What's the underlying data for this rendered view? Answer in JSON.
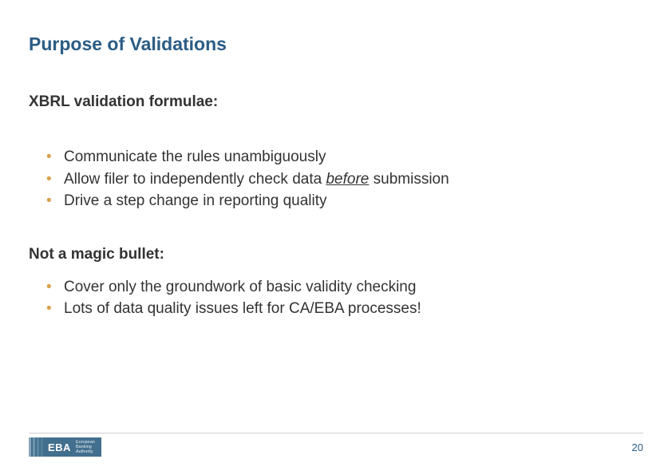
{
  "title": "Purpose of Validations",
  "sections": [
    {
      "heading": "XBRL validation formulae:",
      "items": [
        {
          "pre": "Communicate the rules unambiguously",
          "em": "",
          "post": ""
        },
        {
          "pre": "Allow filer to independently check data ",
          "em": "before",
          "post": " submission"
        },
        {
          "pre": "Drive a step change in reporting quality",
          "em": "",
          "post": ""
        }
      ]
    },
    {
      "heading": "Not a magic bullet:",
      "items": [
        {
          "pre": "Cover only the groundwork of basic validity checking",
          "em": "",
          "post": ""
        },
        {
          "pre": "Lots of data quality issues left for CA/EBA processes!",
          "em": "",
          "post": ""
        }
      ]
    }
  ],
  "footer": {
    "logo_text": "EBA",
    "logo_sub1": "European",
    "logo_sub2": "Banking",
    "logo_sub3": "Authority",
    "page": "20"
  },
  "colors": {
    "title": "#2b5c84",
    "bullet": "#d9a24a",
    "logo_bg": "#426f8e"
  }
}
